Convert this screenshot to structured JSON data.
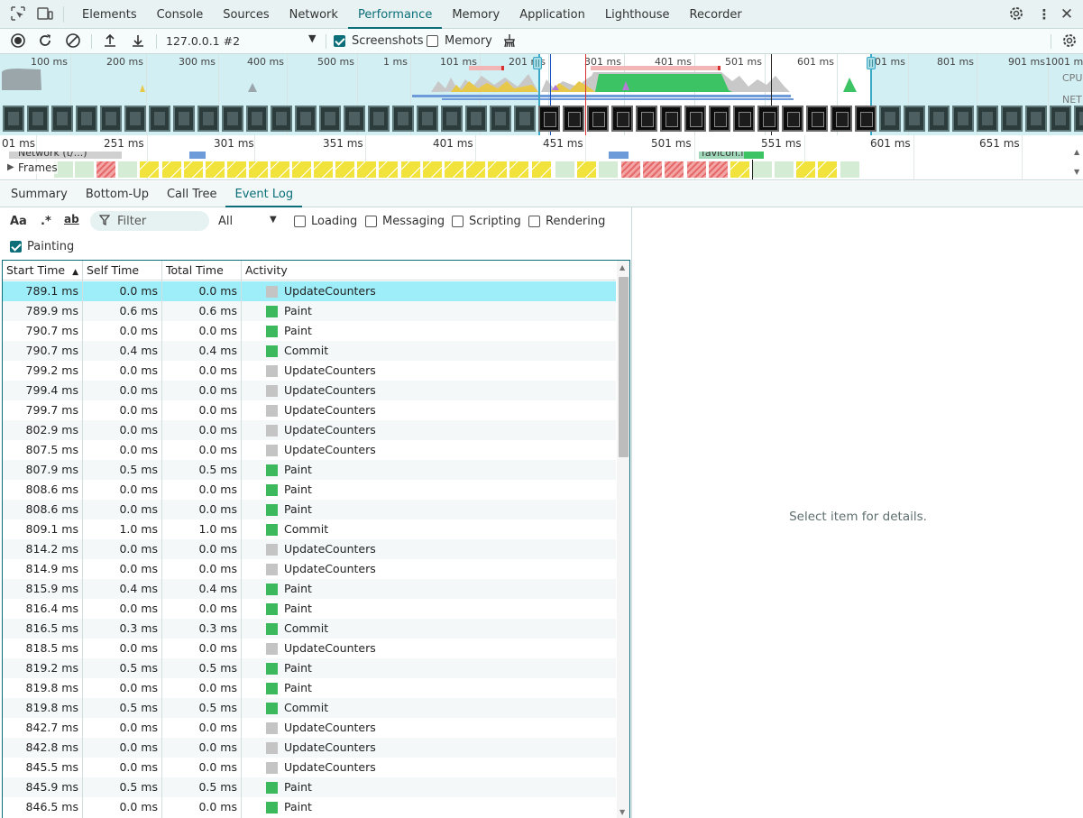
{
  "main_tabs": [
    "Elements",
    "Console",
    "Sources",
    "Network",
    "Performance",
    "Memory",
    "Application",
    "Lighthouse",
    "Recorder"
  ],
  "active_main_tab": "Performance",
  "toolbar": {
    "profile_select": "127.0.0.1 #2",
    "screenshots_label": "Screenshots",
    "screenshots_checked": true,
    "memory_label": "Memory",
    "memory_checked": false
  },
  "overview": {
    "ticks": [
      "100 ms",
      "200 ms",
      "300 ms",
      "400 ms",
      "500 ms",
      "1 ms",
      "101 ms",
      "201 ms",
      "301 ms",
      "401 ms",
      "501 ms",
      "601 ms",
      "701 ms",
      "801 ms",
      "901 ms",
      "1001 ms"
    ],
    "cpu_label": "CPU",
    "net_label": "NET"
  },
  "timeline": {
    "ticks": [
      "01 ms",
      "251 ms",
      "301 ms",
      "351 ms",
      "401 ms",
      "451 ms",
      "501 ms",
      "551 ms",
      "601 ms",
      "651 ms"
    ],
    "network_label": "Network (t/...)",
    "favicon_label": "favicon.i",
    "frames_label": "Frames"
  },
  "bottom_tabs": [
    "Summary",
    "Bottom-Up",
    "Call Tree",
    "Event Log"
  ],
  "active_bottom_tab": "Event Log",
  "filter": {
    "case_label": "Aa",
    "regex_label": ".*",
    "word_label": "ab",
    "placeholder": "Filter",
    "level": "All",
    "categories": [
      {
        "label": "Loading",
        "checked": false
      },
      {
        "label": "Messaging",
        "checked": false
      },
      {
        "label": "Scripting",
        "checked": false
      },
      {
        "label": "Rendering",
        "checked": false
      },
      {
        "label": "Painting",
        "checked": true
      }
    ]
  },
  "table": {
    "columns": [
      "Start Time",
      "Self Time",
      "Total Time",
      "Activity"
    ],
    "rows": [
      [
        "789.1 ms",
        "0.0 ms",
        "0.0 ms",
        "UpdateCounters",
        "gray"
      ],
      [
        "789.9 ms",
        "0.6 ms",
        "0.6 ms",
        "Paint",
        "green"
      ],
      [
        "790.7 ms",
        "0.0 ms",
        "0.0 ms",
        "Paint",
        "green"
      ],
      [
        "790.7 ms",
        "0.4 ms",
        "0.4 ms",
        "Commit",
        "green"
      ],
      [
        "799.2 ms",
        "0.0 ms",
        "0.0 ms",
        "UpdateCounters",
        "gray"
      ],
      [
        "799.4 ms",
        "0.0 ms",
        "0.0 ms",
        "UpdateCounters",
        "gray"
      ],
      [
        "799.7 ms",
        "0.0 ms",
        "0.0 ms",
        "UpdateCounters",
        "gray"
      ],
      [
        "802.9 ms",
        "0.0 ms",
        "0.0 ms",
        "UpdateCounters",
        "gray"
      ],
      [
        "807.5 ms",
        "0.0 ms",
        "0.0 ms",
        "UpdateCounters",
        "gray"
      ],
      [
        "807.9 ms",
        "0.5 ms",
        "0.5 ms",
        "Paint",
        "green"
      ],
      [
        "808.6 ms",
        "0.0 ms",
        "0.0 ms",
        "Paint",
        "green"
      ],
      [
        "808.6 ms",
        "0.0 ms",
        "0.0 ms",
        "Paint",
        "green"
      ],
      [
        "809.1 ms",
        "1.0 ms",
        "1.0 ms",
        "Commit",
        "green"
      ],
      [
        "814.2 ms",
        "0.0 ms",
        "0.0 ms",
        "UpdateCounters",
        "gray"
      ],
      [
        "814.9 ms",
        "0.0 ms",
        "0.0 ms",
        "UpdateCounters",
        "gray"
      ],
      [
        "815.9 ms",
        "0.4 ms",
        "0.4 ms",
        "Paint",
        "green"
      ],
      [
        "816.4 ms",
        "0.0 ms",
        "0.0 ms",
        "Paint",
        "green"
      ],
      [
        "816.5 ms",
        "0.3 ms",
        "0.3 ms",
        "Commit",
        "green"
      ],
      [
        "818.5 ms",
        "0.0 ms",
        "0.0 ms",
        "UpdateCounters",
        "gray"
      ],
      [
        "819.2 ms",
        "0.5 ms",
        "0.5 ms",
        "Paint",
        "green"
      ],
      [
        "819.8 ms",
        "0.0 ms",
        "0.0 ms",
        "Paint",
        "green"
      ],
      [
        "819.8 ms",
        "0.5 ms",
        "0.5 ms",
        "Commit",
        "green"
      ],
      [
        "842.7 ms",
        "0.0 ms",
        "0.0 ms",
        "UpdateCounters",
        "gray"
      ],
      [
        "842.8 ms",
        "0.0 ms",
        "0.0 ms",
        "UpdateCounters",
        "gray"
      ],
      [
        "845.5 ms",
        "0.0 ms",
        "0.0 ms",
        "UpdateCounters",
        "gray"
      ],
      [
        "845.9 ms",
        "0.5 ms",
        "0.5 ms",
        "Paint",
        "green"
      ],
      [
        "846.5 ms",
        "0.0 ms",
        "0.0 ms",
        "Paint",
        "green"
      ]
    ]
  },
  "details": {
    "empty_message": "Select item for details."
  },
  "colors": {
    "accent": "#0b6e78",
    "selected_row": "#9eeefa",
    "paint_green": "#3cb95c",
    "counters_gray": "#c4c4c4"
  }
}
